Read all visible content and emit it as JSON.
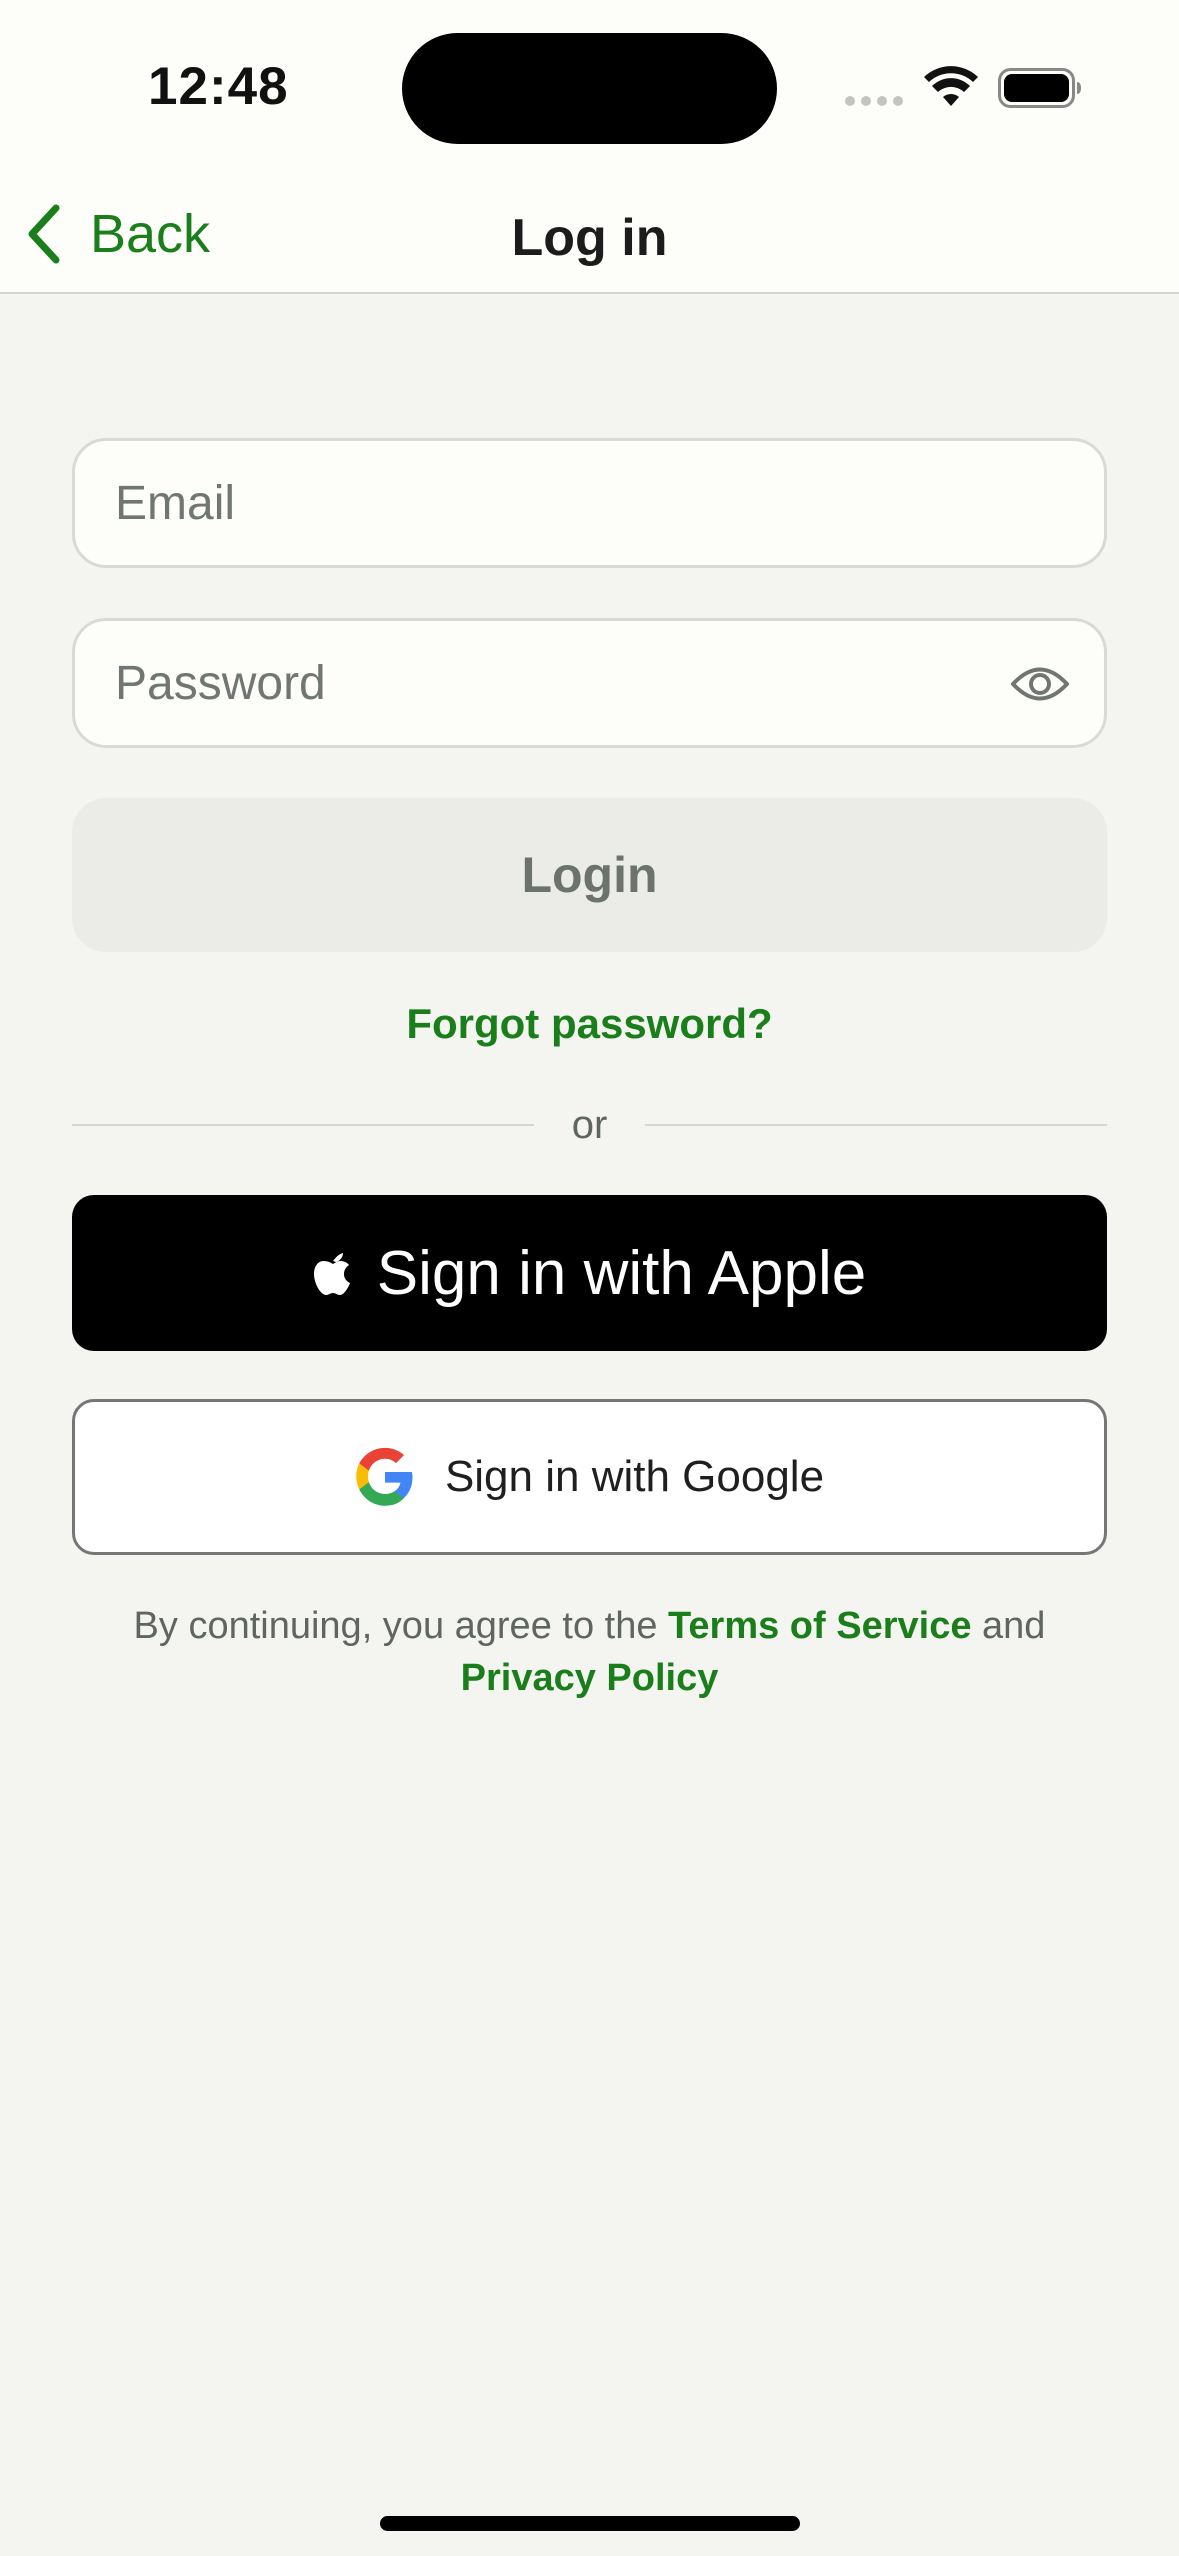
{
  "status_bar": {
    "time": "12:48"
  },
  "nav": {
    "back_label": "Back",
    "title": "Log in"
  },
  "form": {
    "email_placeholder": "Email",
    "email_value": "",
    "password_placeholder": "Password",
    "password_value": "",
    "login_label": "Login",
    "forgot_label": "Forgot password?"
  },
  "divider": {
    "label": "or"
  },
  "social": {
    "apple_label": "Sign in with Apple",
    "google_label": "Sign in with Google"
  },
  "legal": {
    "prefix": "By continuing, you agree to the ",
    "terms_label": "Terms of Service",
    "middle": " and",
    "privacy_label": "Privacy Policy"
  },
  "colors": {
    "accent": "#1a7f1a",
    "background": "#f4f4f1",
    "surface": "#fdfdf9",
    "login_disabled_bg": "#ebebe7",
    "apple_bg": "#000000"
  },
  "icons": {
    "back": "chevron-left-icon",
    "password_toggle": "eye-icon",
    "apple": "apple-logo-icon",
    "google": "google-logo-icon"
  }
}
